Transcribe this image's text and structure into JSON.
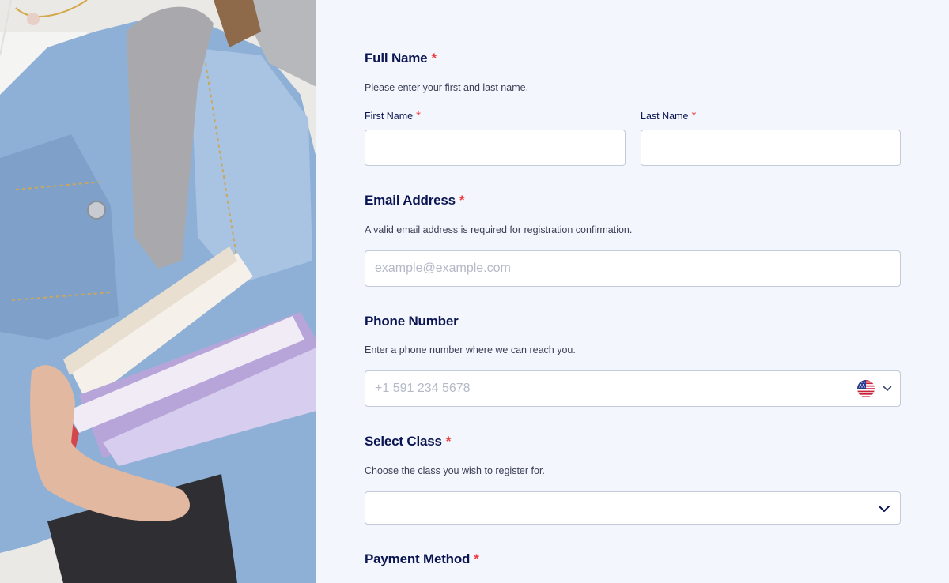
{
  "full_name": {
    "title": "Full Name",
    "required_mark": "*",
    "hint": "Please enter your first and last name.",
    "first": {
      "label": "First Name",
      "required_mark": "*",
      "value": "",
      "placeholder": ""
    },
    "last": {
      "label": "Last Name",
      "required_mark": "*",
      "value": "",
      "placeholder": ""
    }
  },
  "email": {
    "title": "Email Address",
    "required_mark": "*",
    "hint": "A valid email address is required for registration confirmation.",
    "placeholder": "example@example.com",
    "value": ""
  },
  "phone": {
    "title": "Phone Number",
    "hint": "Enter a phone number where we can reach you.",
    "placeholder": "+1 591 234 5678",
    "value": "",
    "country_icon": "us-flag-icon"
  },
  "select_class": {
    "title": "Select Class",
    "required_mark": "*",
    "hint": "Choose the class you wish to register for.",
    "selected": ""
  },
  "payment": {
    "title": "Payment Method",
    "required_mark": "*"
  },
  "colors": {
    "background": "#f3f6fd",
    "heading": "#0a1551",
    "required": "#f23a3c",
    "border": "#c3cad8",
    "placeholder": "#b4b9c7"
  },
  "image": {
    "icon": "student-holding-books-photo"
  }
}
